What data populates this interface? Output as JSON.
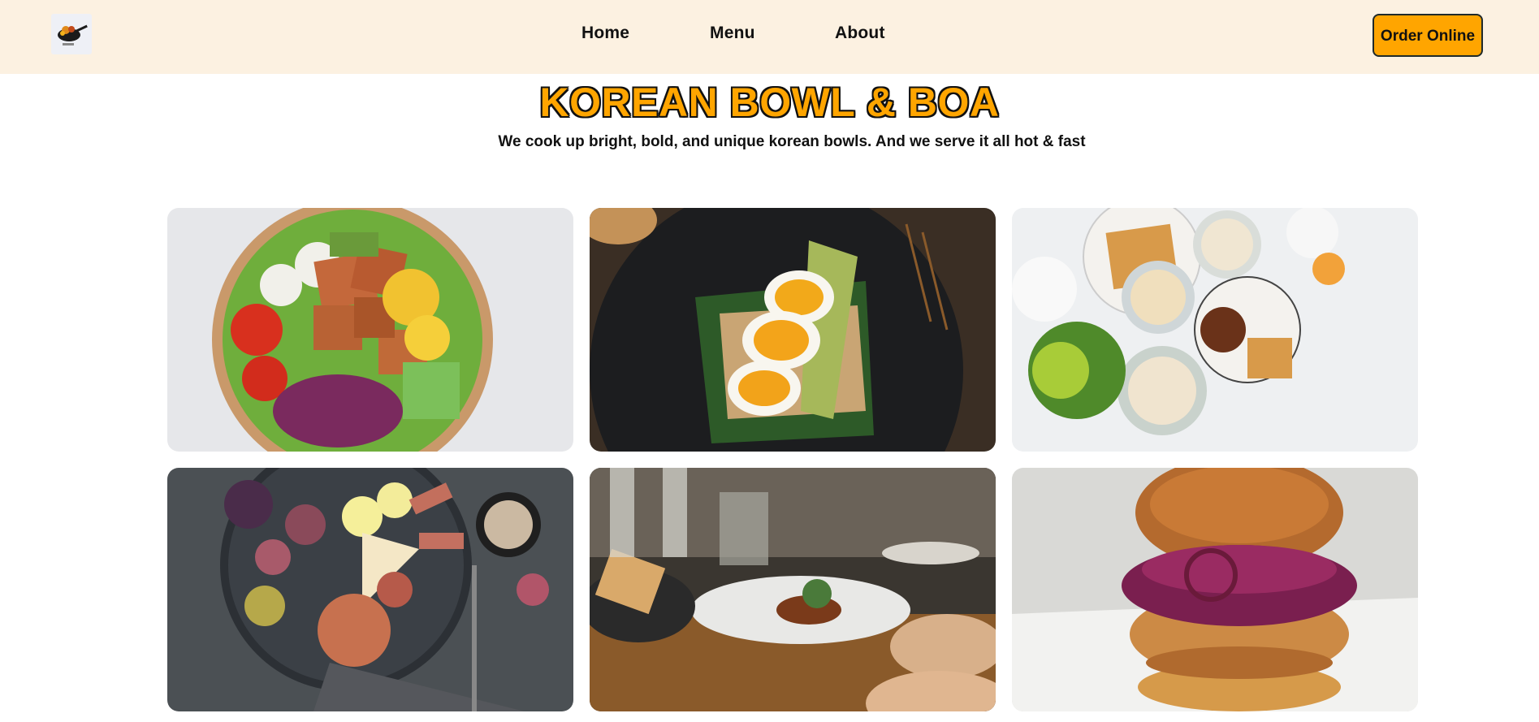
{
  "nav": {
    "logo_alt": "logo",
    "links": [
      "Home",
      "Menu",
      "About"
    ],
    "order_label": "Order Online"
  },
  "hero": {
    "title": "KOREAN BOWL & BOA",
    "subtitle": "We cook up bright, bold, and unique korean bowls. And we serve it all hot & fast"
  },
  "gallery": {
    "photos": [
      {
        "alt": "salmon salad bowl",
        "background": "#e6e7ea"
      },
      {
        "alt": "egg avocado toast",
        "background": "#2b2a27"
      },
      {
        "alt": "breakfast spread",
        "background": "#eef0f2"
      },
      {
        "alt": "figs and cheese platter",
        "background": "#4b5054"
      },
      {
        "alt": "restaurant dinner table",
        "background": "#3a3630"
      },
      {
        "alt": "fried chicken burger",
        "background": "#d9d9d6"
      }
    ]
  }
}
